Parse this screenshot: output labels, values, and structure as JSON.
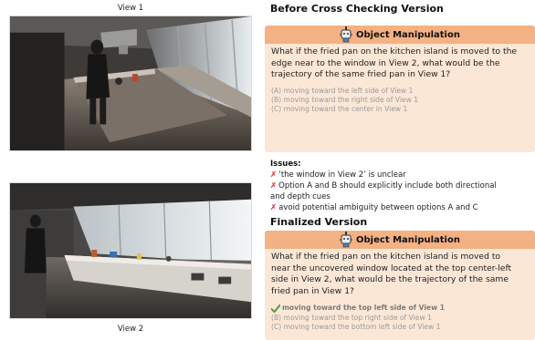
{
  "views": {
    "view1_caption": "View 1",
    "view2_caption": "View 2"
  },
  "before": {
    "heading": "Before Cross Checking Version",
    "category": "Object Manipulation",
    "question_lines": [
      "What if the fried pan on the kitchen island is moved to the",
      "edge near to the window in View 2, what would be the",
      "trajectory of the same fried pan in View 1?"
    ],
    "options": [
      "(A) moving toward the left side of View 1",
      "(B) moving toward the right side of  View 1",
      "(C) moving toward the center in View 1"
    ]
  },
  "issues": {
    "title": "Issues:",
    "items": [
      "‘the window in View 2’ is unclear",
      "Option A and B should explicitly include both directional",
      "and depth cues",
      "avoid potential ambiguity between options A and C"
    ]
  },
  "finalized": {
    "heading": "Finalized Version",
    "category": "Object Manipulation",
    "question_lines": [
      "What if the fried pan on the kitchen island is moved to",
      "near the uncovered window located at the top center-left",
      "side in View 2, what would be the trajectory of the same",
      "fried pan in View 1?"
    ],
    "correct_option": "moving toward the top left side of View 1",
    "options": [
      "(B) moving toward the top right side of View 1",
      "(C) moving toward the bottom left side of View 1"
    ]
  },
  "colors": {
    "card_header": "#f4b183",
    "card_body": "#fbe7d6",
    "issue_mark": "#e0202a",
    "check_mark": "#5a9a3a"
  },
  "icons": {
    "category_icon": "robot-arm-icon",
    "issue_icon": "x-mark",
    "correct_icon": "check-mark-icon"
  }
}
